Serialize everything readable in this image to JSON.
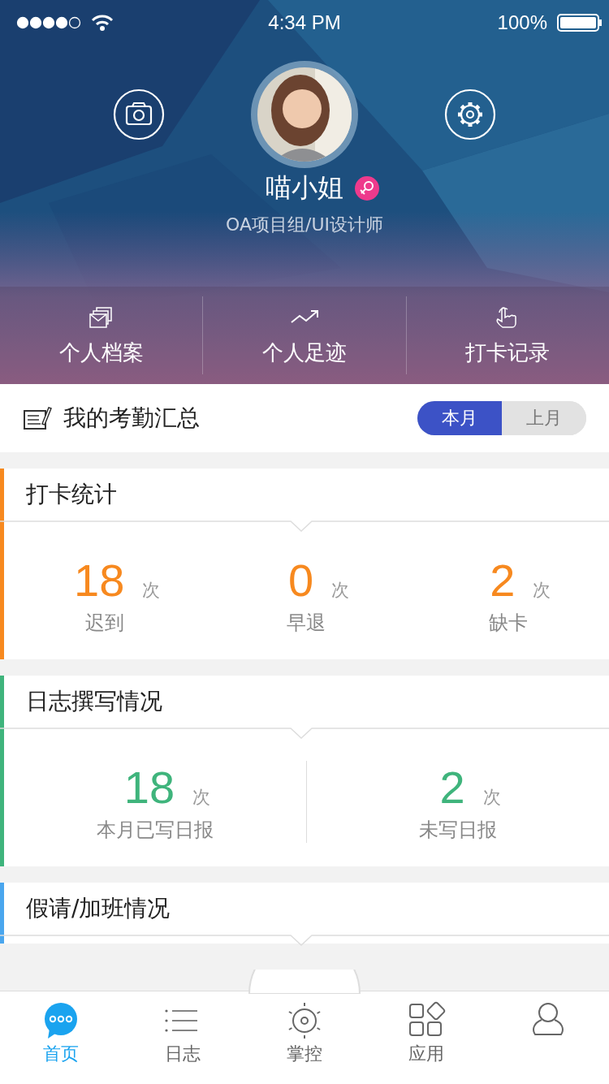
{
  "status_bar": {
    "time": "4:34 PM",
    "battery": "100%"
  },
  "profile": {
    "name": "喵小姐",
    "subtitle": "OA项目组/UI设计师"
  },
  "quick_links": [
    {
      "kind": "files",
      "label": "个人档案"
    },
    {
      "kind": "trend",
      "label": "个人足迹"
    },
    {
      "kind": "tap",
      "label": "打卡记录"
    }
  ],
  "summary": {
    "title": "我的考勤汇总",
    "periods": [
      {
        "label": "本月",
        "selected": true
      },
      {
        "label": "上月",
        "selected": false
      }
    ]
  },
  "sections": [
    {
      "title": "打卡统计",
      "color": "#f7891f",
      "stats": [
        {
          "value": "18",
          "unit": "次",
          "label": "迟到"
        },
        {
          "value": "0",
          "unit": "次",
          "label": "早退"
        },
        {
          "value": "2",
          "unit": "次",
          "label": "缺卡"
        }
      ]
    },
    {
      "title": "日志撰写情况",
      "color": "#3fb47c",
      "stats": [
        {
          "value": "18",
          "unit": "次",
          "label": "本月已写日报"
        },
        {
          "value": "2",
          "unit": "次",
          "label": "未写日报"
        }
      ]
    },
    {
      "title": "假请/加班情况",
      "color": "#4aa6ee"
    }
  ],
  "tabs": [
    {
      "kind": "chat",
      "label": "首页",
      "selected": true
    },
    {
      "kind": "list",
      "label": "日志",
      "selected": false
    },
    {
      "kind": "sun",
      "label": "掌控",
      "selected": false
    },
    {
      "kind": "apps",
      "label": "应用",
      "selected": false
    },
    {
      "kind": "person",
      "selected": false
    }
  ]
}
